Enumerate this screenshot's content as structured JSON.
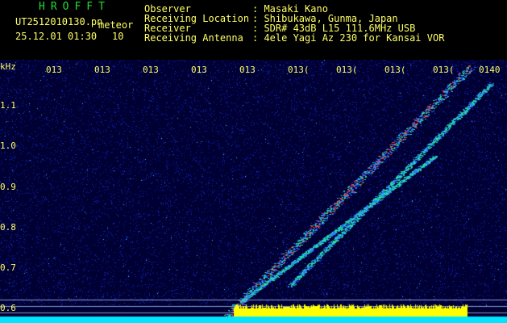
{
  "header": {
    "brand": "HROFFT",
    "filename": "UT2512010130.pn",
    "mode": "meteor",
    "datetime": "25.12.01 01:30",
    "count": "10",
    "rows": [
      {
        "label": "Observer",
        "value": ": Masaki Kano"
      },
      {
        "label": "Receiving Location",
        "value": ": Shibukawa, Gunma, Japan"
      },
      {
        "label": "Receiver",
        "value": ": SDR# 43dB L15 111.6MHz USB"
      },
      {
        "label": "Receiving Antenna",
        "value": ": 4ele Yagi Az 230 for Kansai VOR"
      }
    ]
  },
  "spectrogram": {
    "freq_unit": "kHz",
    "y_ticks": [
      "1.1",
      "1.0",
      "0.9",
      "0.8",
      "0.7",
      "0.6"
    ],
    "time_ticks": [
      "013",
      "013",
      "013",
      "013",
      "013",
      "013(",
      "013(",
      "013(",
      "013(",
      "0140"
    ],
    "colors": {
      "background": "#000033",
      "noise": "#1a2fd0",
      "trace": "#ff3030",
      "signal_bar": "#ffff00",
      "baseline": "#00e5ff"
    }
  }
}
